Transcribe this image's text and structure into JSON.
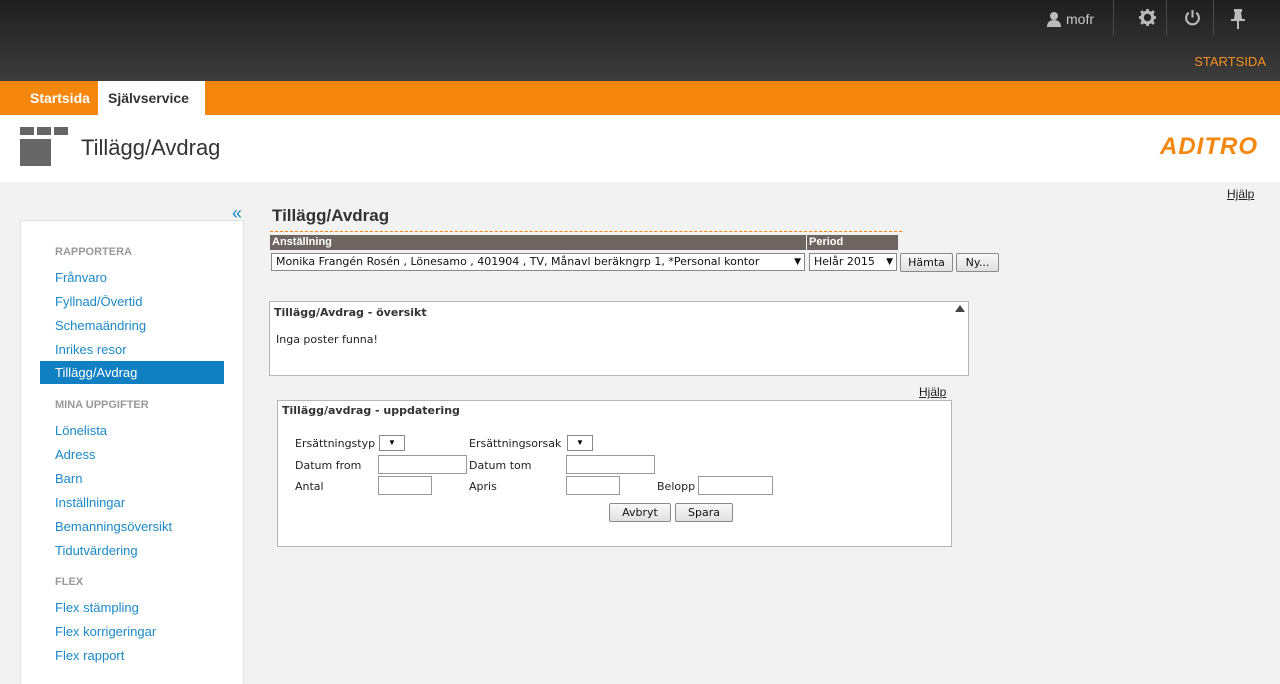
{
  "topbar": {
    "username": "mofr",
    "start_link": "STARTSIDA"
  },
  "tabs": [
    "Startsida",
    "Självservice"
  ],
  "header": {
    "title": "Tillägg/Avdrag",
    "brand": "ADITRO",
    "help": "Hjälp"
  },
  "sidebar": {
    "collapse": "«",
    "sections": [
      {
        "heading": "RAPPORTERA",
        "items": [
          "Frånvaro",
          "Fyllnad/Övertid",
          "Schemaändring",
          "Inrikes resor",
          "Tillägg/Avdrag"
        ]
      },
      {
        "heading": "MINA UPPGIFTER",
        "items": [
          "Lönelista",
          "Adress",
          "Barn",
          "Inställningar",
          "Bemanningsöversikt",
          "Tidutvärdering"
        ]
      },
      {
        "heading": "FLEX",
        "items": [
          "Flex stämpling",
          "Flex korrigeringar",
          "Flex rapport"
        ]
      }
    ],
    "active": "Tillägg/Avdrag"
  },
  "main": {
    "title": "Tillägg/Avdrag",
    "col_employment": "Anställning",
    "col_period": "Period",
    "employment_value": "Monika Frangén Rosén , Lönesamo , 401904 , TV, Månavl beräkngrp 1, *Personal kontor",
    "period_value": "Helår 2015",
    "fetch_button": "Hämta",
    "new_button": "Ny...",
    "overview_title": "Tillägg/Avdrag - översikt",
    "overview_empty": "Inga poster funna!",
    "help": "Hjälp",
    "update_title": "Tillägg/avdrag - uppdatering",
    "labels": {
      "comp_type": "Ersättningstyp",
      "comp_reason": "Ersättningsorsak",
      "date_from": "Datum from",
      "date_to": "Datum tom",
      "quantity": "Antal",
      "unit_price": "Apris",
      "amount": "Belopp"
    },
    "cancel_button": "Avbryt",
    "save_button": "Spara"
  },
  "colors": {
    "accent": "#f5870f",
    "link": "#1b88c9",
    "active": "#1180c3"
  }
}
